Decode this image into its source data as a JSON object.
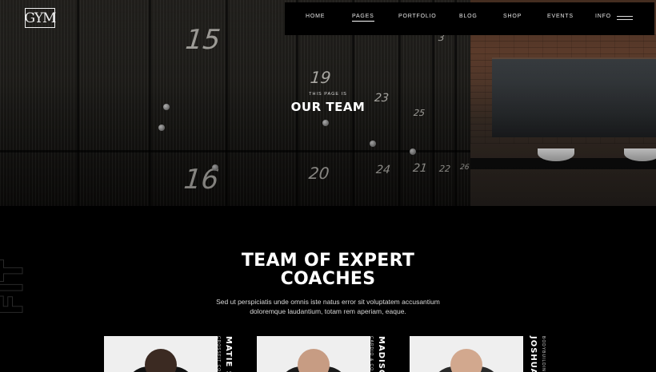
{
  "brand": {
    "logo_text": "GYM"
  },
  "nav": {
    "items": [
      {
        "label": "HOME",
        "active": false
      },
      {
        "label": "PAGES",
        "active": true
      },
      {
        "label": "PORTFOLIO",
        "active": false
      },
      {
        "label": "BLOG",
        "active": false
      },
      {
        "label": "SHOP",
        "active": false
      },
      {
        "label": "EVENTS",
        "active": false
      }
    ],
    "info_label": "INFO",
    "menu_icon": "hamburger-icon"
  },
  "hero": {
    "subtitle": "THIS PAGE IS",
    "title": "OUR TEAM",
    "locker_numbers": [
      "15",
      "16",
      "19",
      "20",
      "21",
      "23",
      "24",
      "3",
      "22",
      "25",
      "26"
    ]
  },
  "section": {
    "title_line1": "TEAM OF EXPERT",
    "title_line2": "COACHES",
    "description": "Sed ut perspiciatis unde omnis iste natus error sit voluptatem accusantium doloremque laudantium, totam rem aperiam, eaque.",
    "side_deco_text": "FIT"
  },
  "team": [
    {
      "name": "MATIE SI",
      "role": "CROSSFIT CO",
      "skin": "#3b2a22",
      "shirt": "#111111"
    },
    {
      "name": "MADISO",
      "role": "CARDIO & CO",
      "skin": "#c79c83",
      "shirt": "#1a1a1a"
    },
    {
      "name": "JOSHUA",
      "role": "BODYBUILDIN",
      "skin": "#d2a88e",
      "shirt": "#2a2a2a"
    }
  ]
}
